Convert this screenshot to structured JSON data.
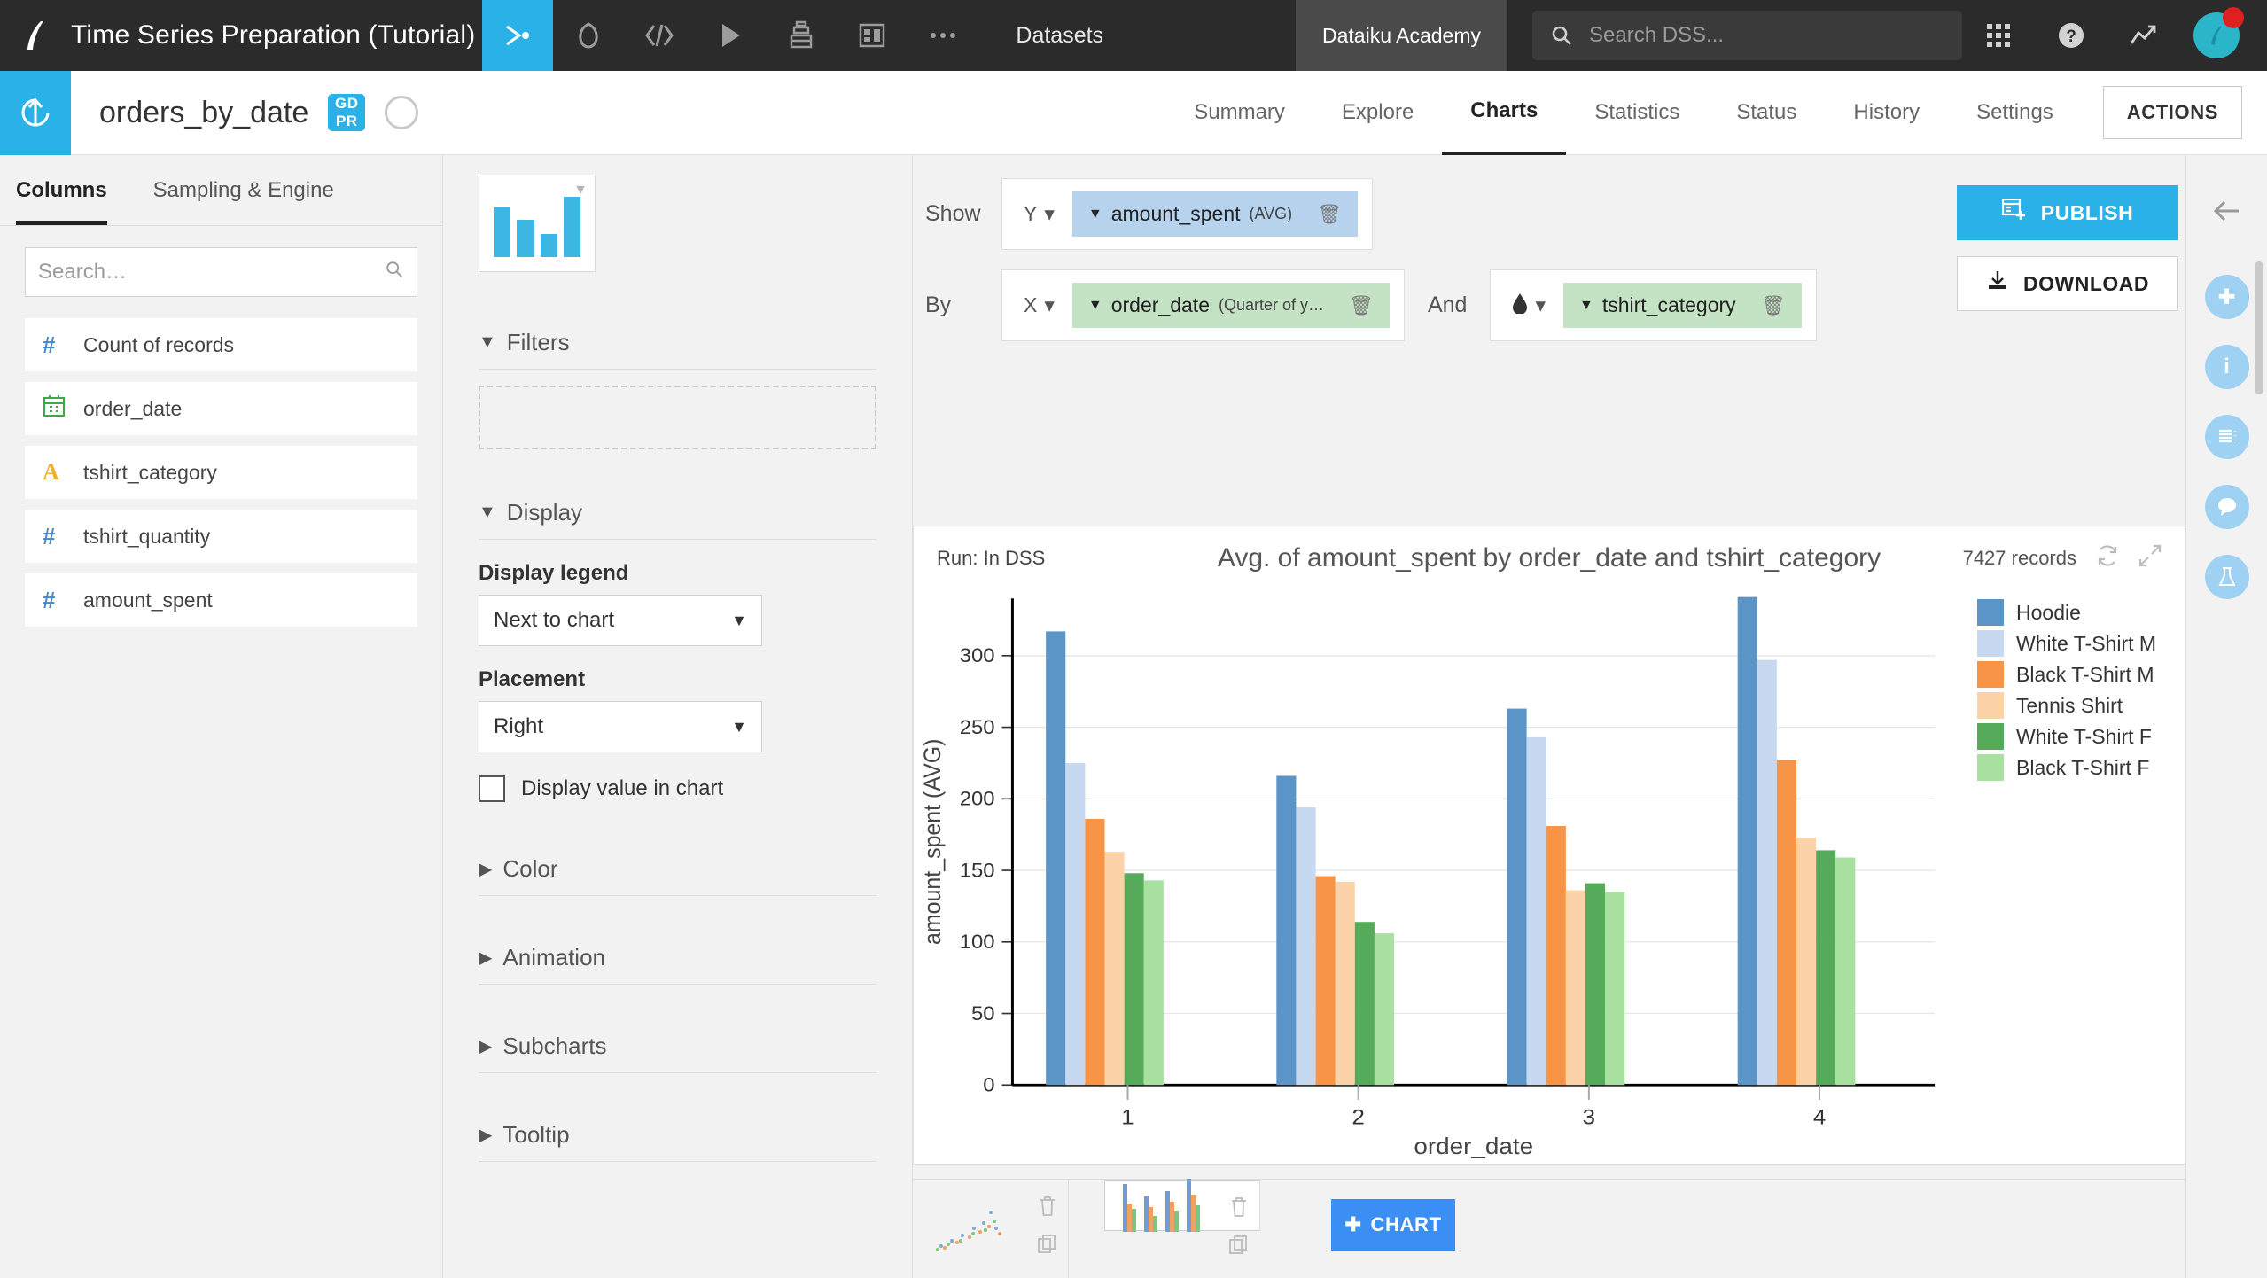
{
  "topbar": {
    "project_title": "Time Series Preparation (Tutorial)",
    "logo_icon": "dataiku-logo-icon",
    "nav_icons": [
      "flow-icon",
      "recipes-icon",
      "code-icon",
      "jobs-icon",
      "notebooks-icon",
      "dashboards-icon",
      "more-icon"
    ],
    "datasets_label": "Datasets",
    "academy_label": "Dataiku Academy",
    "search_placeholder": "Search DSS...",
    "search_value": "",
    "apps_icon": "grid-apps-icon",
    "help_icon": "help-icon",
    "activity_icon": "trending-icon",
    "avatar_icon": "user-avatar",
    "notification_color": "#e02020",
    "accent_color": "#2ab1e8"
  },
  "dataset_header": {
    "back_icon": "upload-arrow-icon",
    "name": "orders_by_date",
    "gdpr_top": "GD",
    "gdpr_bottom": "PR",
    "compass_icon": "compass-icon",
    "tabs": [
      {
        "label": "Summary",
        "active": false
      },
      {
        "label": "Explore",
        "active": false
      },
      {
        "label": "Charts",
        "active": true
      },
      {
        "label": "Statistics",
        "active": false
      },
      {
        "label": "Status",
        "active": false
      },
      {
        "label": "History",
        "active": false
      },
      {
        "label": "Settings",
        "active": false
      }
    ],
    "actions_label": "ACTIONS"
  },
  "left_panel": {
    "tabs": [
      {
        "label": "Columns",
        "active": true
      },
      {
        "label": "Sampling & Engine",
        "active": false
      }
    ],
    "search_placeholder": "Search…",
    "search_value": "",
    "columns": [
      {
        "name": "Count of records",
        "type": "number",
        "glyph": "#"
      },
      {
        "name": "order_date",
        "type": "date",
        "glyph": "date-icon"
      },
      {
        "name": "tshirt_category",
        "type": "string",
        "glyph": "A"
      },
      {
        "name": "tshirt_quantity",
        "type": "number",
        "glyph": "#"
      },
      {
        "name": "amount_spent",
        "type": "number",
        "glyph": "#"
      }
    ]
  },
  "options_panel": {
    "chart_type_icon": "bar-chart-type-icon",
    "sections": [
      {
        "label": "Filters",
        "expanded": true
      },
      {
        "label": "Display",
        "expanded": true
      },
      {
        "label": "Color",
        "expanded": false
      },
      {
        "label": "Animation",
        "expanded": false
      },
      {
        "label": "Subcharts",
        "expanded": false
      },
      {
        "label": "Tooltip",
        "expanded": false
      }
    ],
    "display_legend_label": "Display legend",
    "display_legend_value": "Next to chart",
    "placement_label": "Placement",
    "placement_value": "Right",
    "display_value_label": "Display value in chart",
    "display_value_checked": false
  },
  "controls": {
    "show_label": "Show",
    "by_label": "By",
    "and_label": "And",
    "y_axis_label": "Y",
    "x_axis_label": "X",
    "color_axis_icon": "color-drop-icon",
    "y_pill": {
      "field": "amount_spent",
      "agg": "(AVG)"
    },
    "x_pill": {
      "field": "order_date",
      "agg": "(Quarter of y…"
    },
    "color_pill": {
      "field": "tshirt_category",
      "agg": ""
    },
    "trash_icon": "trash-icon"
  },
  "right_buttons": {
    "publish_label": "PUBLISH",
    "publish_icon": "publish-icon",
    "download_label": "DOWNLOAD",
    "download_icon": "download-icon"
  },
  "chart_card": {
    "run_label": "Run: In DSS",
    "record_count": "7427 records",
    "refresh_icon": "refresh-icon",
    "expand_icon": "expand-icon"
  },
  "thumbnails": {
    "charts": [
      {
        "icon": "scatter-thumb-icon",
        "selected": false
      },
      {
        "icon": "bar-thumb-icon",
        "selected": true
      }
    ],
    "delete_icon": "trash-icon",
    "copy_icon": "copy-icon",
    "add_chart_label": "CHART",
    "add_icon": "plus-icon"
  },
  "right_rail": {
    "collapse_icon": "chevron-left-icon",
    "items": [
      {
        "icon": "plus-circle-icon"
      },
      {
        "icon": "info-icon"
      },
      {
        "icon": "details-icon"
      },
      {
        "icon": "discussion-icon"
      },
      {
        "icon": "lab-icon"
      }
    ]
  },
  "chart_data": {
    "type": "bar",
    "title": "Avg. of amount_spent by order_date and tshirt_category",
    "xlabel": "order_date",
    "ylabel": "amount_spent (AVG)",
    "categories": [
      "1",
      "2",
      "3",
      "4"
    ],
    "ylim": [
      0,
      340
    ],
    "yticks": [
      0,
      50,
      100,
      150,
      200,
      250,
      300
    ],
    "grid": true,
    "legend_position": "right",
    "series": [
      {
        "name": "Hoodie",
        "color": "#5b94c6",
        "values": [
          317,
          216,
          263,
          341
        ]
      },
      {
        "name": "White T-Shirt M",
        "color": "#c6d9f0",
        "values": [
          225,
          194,
          243,
          297
        ]
      },
      {
        "name": "Black T-Shirt M",
        "color": "#f79445",
        "values": [
          186,
          146,
          181,
          227
        ]
      },
      {
        "name": "Tennis Shirt",
        "color": "#fcd3a8",
        "values": [
          163,
          142,
          136,
          173
        ]
      },
      {
        "name": "White T-Shirt F",
        "color": "#55ab5a",
        "values": [
          148,
          114,
          141,
          164
        ]
      },
      {
        "name": "Black T-Shirt F",
        "color": "#a8e0a0",
        "values": [
          143,
          106,
          135,
          159
        ]
      }
    ]
  }
}
